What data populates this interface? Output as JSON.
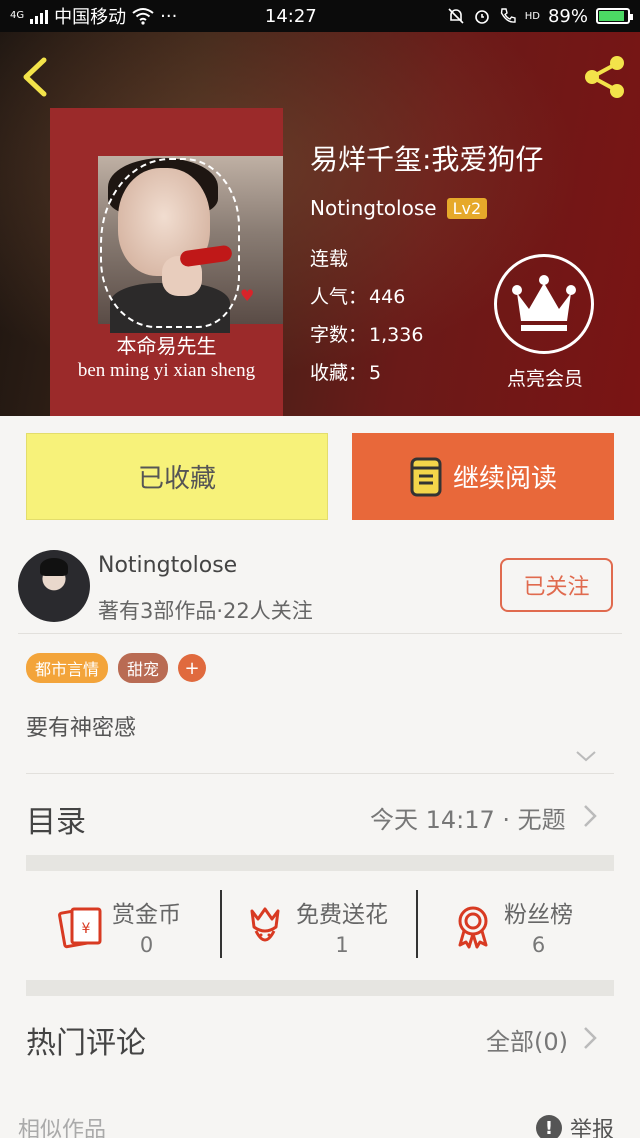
{
  "status_bar": {
    "network": "4G",
    "carrier": "中国移动",
    "more": "···",
    "time": "14:27",
    "hd": "HD",
    "battery": "89%",
    "battery_level": 0.89
  },
  "book": {
    "title": "易烊千玺:我爱狗仔",
    "author": "Notingtolose",
    "level": "Lv2",
    "status": "连载",
    "popularity_label": "人气：",
    "popularity": "446",
    "words_label": "字数：",
    "words": "1,336",
    "favorites_label": "收藏：",
    "favorites": "5",
    "cover_line1": "本命易先生",
    "cover_line2": "ben ming yi xian sheng"
  },
  "vip": {
    "label": "点亮会员"
  },
  "actions": {
    "favorited": "已收藏",
    "continue_reading": "继续阅读"
  },
  "author_card": {
    "name": "Notingtolose",
    "stats": "著有3部作品·22人关注",
    "follow": "已关注"
  },
  "tags": [
    "都市言情",
    "甜宠"
  ],
  "tag_add": "+",
  "intro": "要有神密感",
  "toc": {
    "label": "目录",
    "latest": "今天 14:17 · 无题"
  },
  "stats": [
    {
      "label": "赏金币",
      "value": "0",
      "icon": "red-envelope-icon"
    },
    {
      "label": "免费送花",
      "value": "1",
      "icon": "flower-icon"
    },
    {
      "label": "粉丝榜",
      "value": "6",
      "icon": "medal-icon"
    }
  ],
  "comments": {
    "label": "热门评论",
    "all": "全部(0)"
  },
  "footer": {
    "similar": "相似作品",
    "report": "举报",
    "report_icon_glyph": "!"
  },
  "colors": {
    "accent_orange": "#e8683a",
    "fav_yellow": "#f7f27a",
    "icon_red": "#d83a22",
    "level_badge": "#e6a92a"
  }
}
